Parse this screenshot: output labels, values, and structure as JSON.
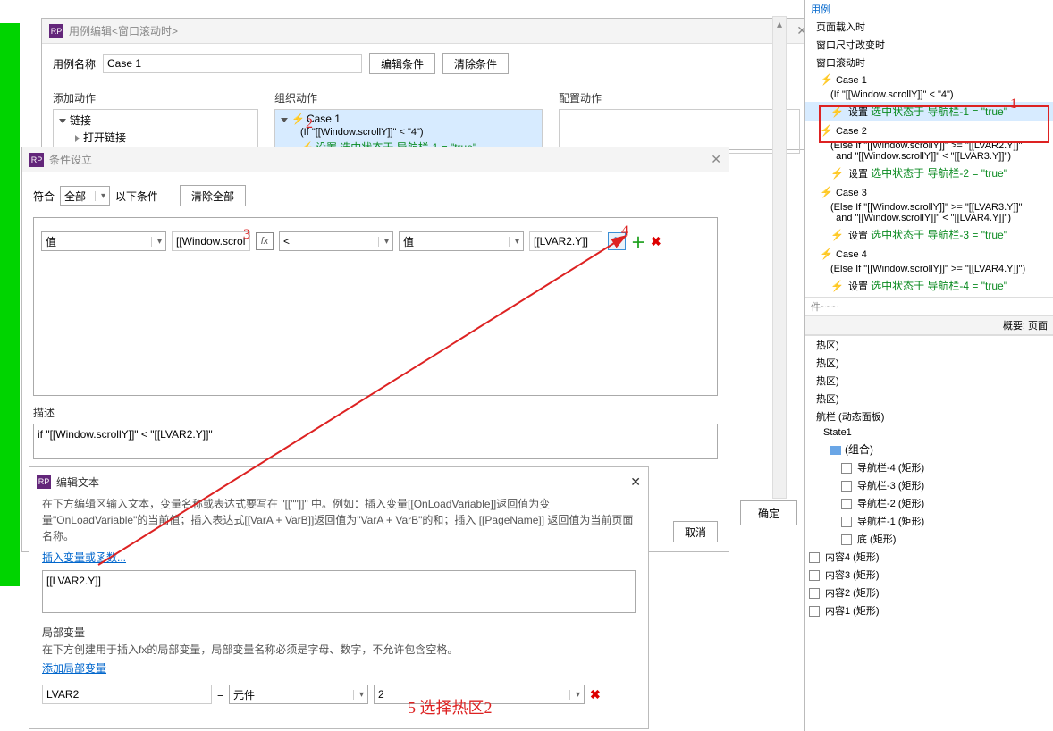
{
  "green_strip": true,
  "case_editor": {
    "title": "用例编辑<窗口滚动时>",
    "name_label": "用例名称",
    "name_value": "Case 1",
    "edit_cond_btn": "编辑条件",
    "clear_cond_btn": "清除条件",
    "add_action_label": "添加动作",
    "org_action_label": "组织动作",
    "config_action_label": "配置动作",
    "link_group": "链接",
    "open_link_item": "打开链接",
    "case_tree": {
      "case_label": "Case 1",
      "cond_text": "(If \"[[Window.scrollY]]\" < \"4\")",
      "action_text": "设置 选中状态于 导航栏-1 = \"true\""
    }
  },
  "condition_dialog": {
    "title": "条件设立",
    "match_label": "符合",
    "match_value": "全部",
    "match_suffix": "以下条件",
    "clear_all_btn": "清除全部",
    "row": {
      "left_type": "值",
      "left_value": "[[Window.scrollY]]",
      "op": "<",
      "right_type": "值",
      "right_value": "[[LVAR2.Y]]"
    },
    "desc_label": "描述",
    "desc_text": "if \"[[Window.scrollY]]\" < \"[[LVAR2.Y]]\"",
    "ok_btn": "确定",
    "cancel_btn": "取消"
  },
  "text_editor": {
    "title": "编辑文本",
    "help_text": "在下方编辑区输入文本，变量名称或表达式要写在 \"[[\"\"]]\" 中。例如：插入变量[[OnLoadVariable]]返回值为变量\"OnLoadVariable\"的当前值；插入表达式[[VarA + VarB]]返回值为\"VarA + VarB\"的和；插入 [[PageName]] 返回值为当前页面名称。",
    "insert_link": "插入变量或函数...",
    "value": "[[LVAR2.Y]]",
    "local_var_label": "局部变量",
    "local_var_help": "在下方创建用于插入fx的局部变量，局部变量名称必须是字母、数字，不允许包含空格。",
    "add_local_link": "添加局部变量",
    "var_name": "LVAR2",
    "eq": "=",
    "var_source": "元件",
    "var_target": "2"
  },
  "right_panel": {
    "top_link": "用例",
    "events": [
      "页面载入时",
      "窗口尺寸改变时",
      "窗口滚动时"
    ],
    "cases": [
      {
        "name": "Case 1",
        "cond": "(If \"[[Window.scrollY]]\" < \"4\")",
        "action_prefix": "设置",
        "action_green": "选中状态于 导航栏-1 = \"true\"",
        "hl": true
      },
      {
        "name": "Case 2",
        "cond": "(Else If \"[[Window.scrollY]]\" >= \"[[LVAR2.Y]]\"\n  and \"[[Window.scrollY]]\" < \"[[LVAR3.Y]]\")",
        "action_prefix": "设置",
        "action_green": "选中状态于 导航栏-2 = \"true\""
      },
      {
        "name": "Case 3",
        "cond": "(Else If \"[[Window.scrollY]]\" >= \"[[LVAR3.Y]]\"\n  and \"[[Window.scrollY]]\" < \"[[LVAR4.Y]]\")",
        "action_prefix": "设置",
        "action_green": "选中状态于 导航栏-3 = \"true\""
      },
      {
        "name": "Case 4",
        "cond": "(Else If \"[[Window.scrollY]]\" >= \"[[LVAR4.Y]]\")",
        "action_prefix": "设置",
        "action_green": "选中状态于 导航栏-4 = \"true\""
      }
    ],
    "more": "件~~~",
    "summary": "概要: 页面",
    "outline_items": [
      "热区)",
      "热区)",
      "热区)",
      "热区)"
    ],
    "dyn_panel": "航栏 (动态面板)",
    "state": "State1",
    "group": "(组合)",
    "nav_items": [
      "导航栏-4 (矩形)",
      "导航栏-3 (矩形)",
      "导航栏-2 (矩形)",
      "导航栏-1 (矩形)",
      "底 (矩形)"
    ],
    "content_items": [
      "内容4 (矩形)",
      "内容3 (矩形)",
      "内容2 (矩形)",
      "内容1 (矩形)"
    ],
    "buttons": {
      "ok": "确定",
      "cancel": "取消"
    }
  },
  "annotations": {
    "a1": "1",
    "a2": "2",
    "a3": "3",
    "a4": "4",
    "a5": "5   选择热区2"
  }
}
